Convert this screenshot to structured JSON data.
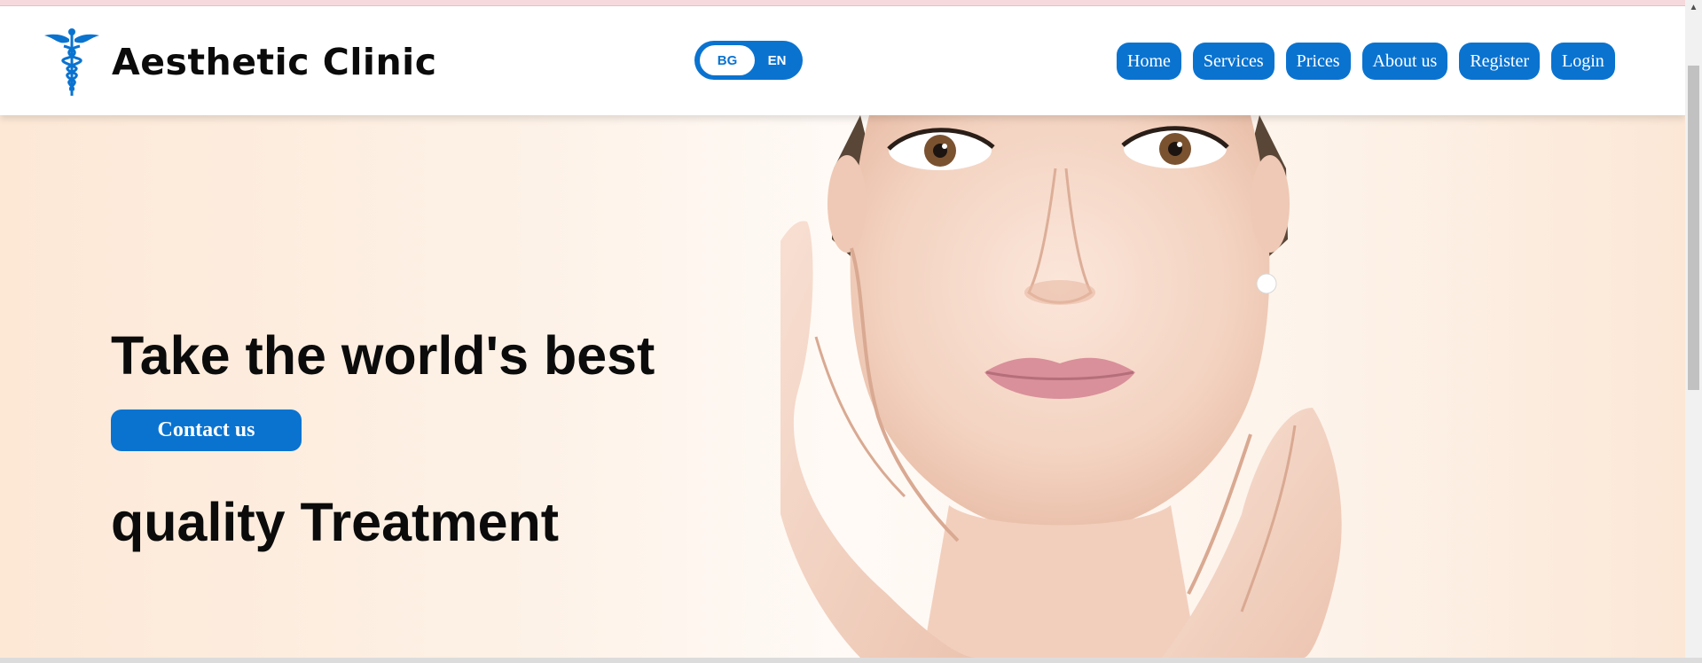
{
  "brand": {
    "name": "Aesthetic Clinic",
    "logo_icon": "caduceus-icon"
  },
  "language": {
    "options": [
      "BG",
      "EN"
    ],
    "selected": "BG"
  },
  "nav": {
    "items": [
      {
        "label": "Home"
      },
      {
        "label": "Services"
      },
      {
        "label": "Prices"
      },
      {
        "label": "About us"
      },
      {
        "label": "Register"
      },
      {
        "label": "Login"
      }
    ]
  },
  "hero": {
    "title_line1": "Take the world's best",
    "title_line2": "quality Treatment",
    "cta_label": "Contact us"
  },
  "colors": {
    "accent": "#0a73d0",
    "hero_background": "#fdefe3",
    "text": "#0b0b0b"
  }
}
